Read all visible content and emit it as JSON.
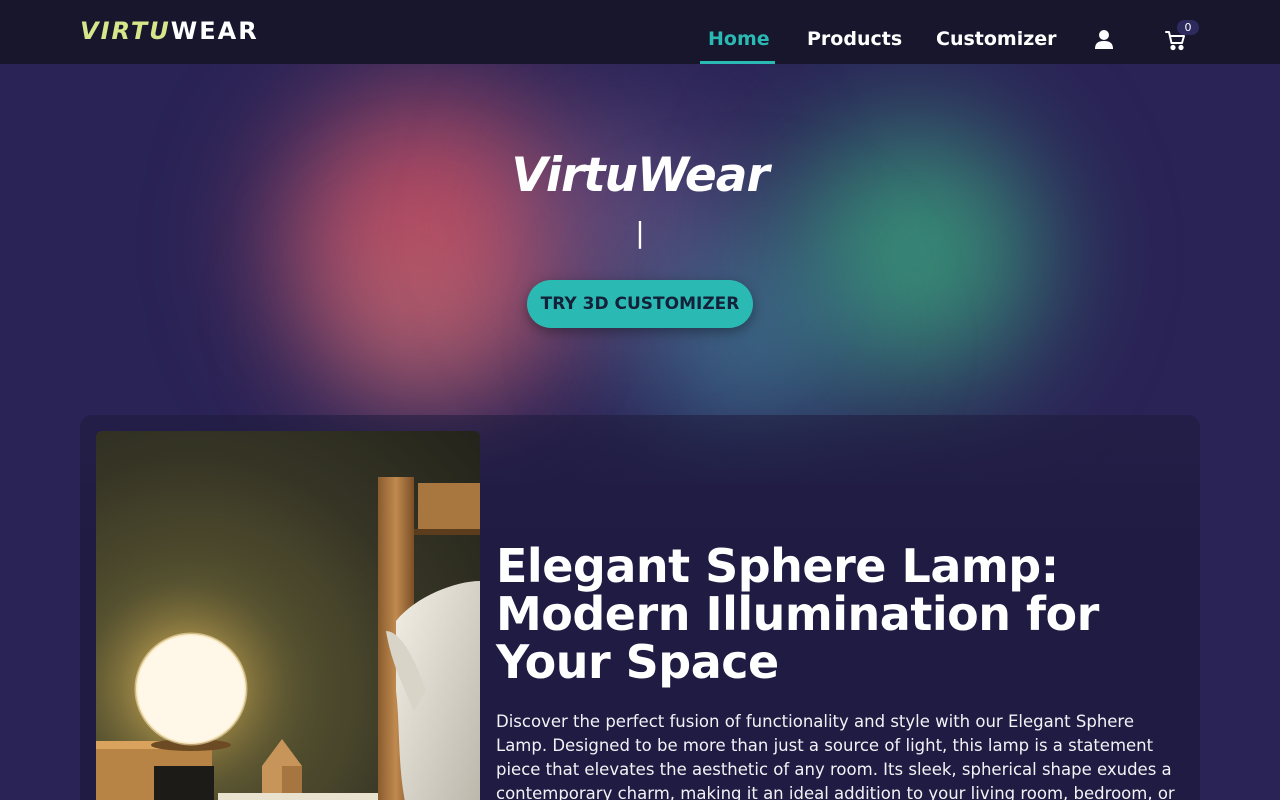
{
  "brand": {
    "part1": "VIRTU",
    "part2": "WEAR"
  },
  "nav": {
    "home": "Home",
    "products": "Products",
    "customizer": "Customizer",
    "cart_count": "0"
  },
  "hero": {
    "title": "VirtuWear",
    "cursor": "|",
    "cta": "TRY 3D CUSTOMIZER"
  },
  "product": {
    "title": "Elegant Sphere Lamp: Modern Illumination for Your Space",
    "description": "Discover the perfect fusion of functionality and style with our Elegant Sphere Lamp. Designed to be more than just a source of light, this lamp is a statement piece that elevates the aesthetic of any room. Its sleek, spherical shape exudes a contemporary charm, making it an ideal addition to your living room, bedroom, or office."
  },
  "colors": {
    "accent": "#2bbab3",
    "logo_accent": "#d6e68a",
    "navbar_bg": "#18162d",
    "page_bg": "#2a2356",
    "card_bg": "#1f1b42"
  },
  "icons": {
    "user": "user-icon",
    "cart": "cart-icon"
  }
}
